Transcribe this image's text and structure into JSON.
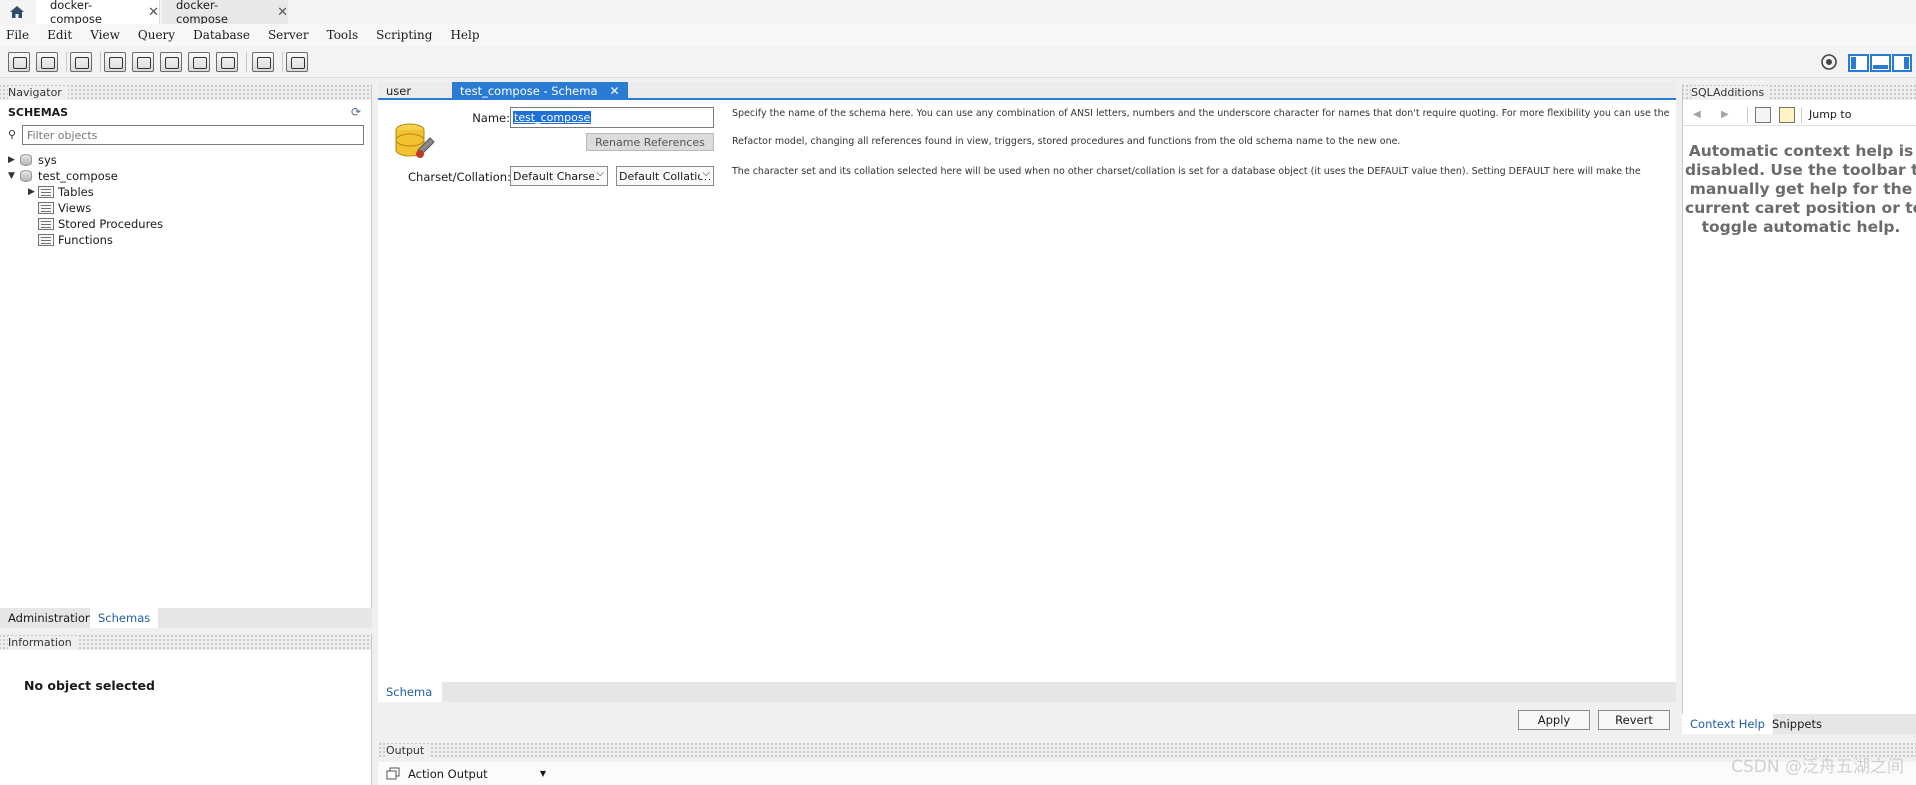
{
  "connection_tabs": [
    {
      "label": "docker-compose",
      "active": true
    },
    {
      "label": "docker-compose",
      "active": false
    }
  ],
  "menu": [
    "File",
    "Edit",
    "View",
    "Query",
    "Database",
    "Server",
    "Tools",
    "Scripting",
    "Help"
  ],
  "navigator": {
    "header": "Navigator",
    "schemas_title": "SCHEMAS",
    "filter_placeholder": "Filter objects",
    "tree": {
      "sys": "sys",
      "test_compose": "test_compose",
      "children": [
        "Tables",
        "Views",
        "Stored Procedures",
        "Functions"
      ]
    },
    "tabs": [
      "Administration",
      "Schemas"
    ]
  },
  "information": {
    "header": "Information",
    "message": "No object selected"
  },
  "editor": {
    "tabs": [
      {
        "label": "user",
        "active": false
      },
      {
        "label": "test_compose - Schema",
        "active": true
      }
    ],
    "name_label": "Name:",
    "name_value": "test_compose",
    "rename_button": "Rename References",
    "charset_label": "Charset/Collation:",
    "charset_value": "Default Charset",
    "collation_value": "Default Collation",
    "help_name": "Specify the name of the schema here. You can use any combination of ANSI letters, numbers and the underscore character for names that don't require quoting. For more flexibility you can use the",
    "help_refactor": "Refactor model, changing all references found in view, triggers, stored procedures and functions from the old schema name to the new one.",
    "help_charset": "The character set and its collation selected here will be used when no other charset/collation is set for a database object (it uses the DEFAULT value then). Setting DEFAULT here will make the",
    "subtab": "Schema",
    "apply": "Apply",
    "revert": "Revert"
  },
  "output": {
    "header": "Output",
    "selector": "Action Output"
  },
  "sql_additions": {
    "header": "SQLAdditions",
    "jump_to": "Jump to",
    "context_help": [
      "Automatic context help is",
      "disabled. Use the toolbar to",
      "manually get help for the",
      "current caret position or to",
      "toggle automatic help."
    ],
    "tabs": [
      "Context Help",
      "Snippets"
    ]
  },
  "watermark": "CSDN @泛舟五湖之间",
  "colors": {
    "accent": "#2a7bd4",
    "link": "#1f5fa8",
    "selection": "#1e6fd8"
  }
}
